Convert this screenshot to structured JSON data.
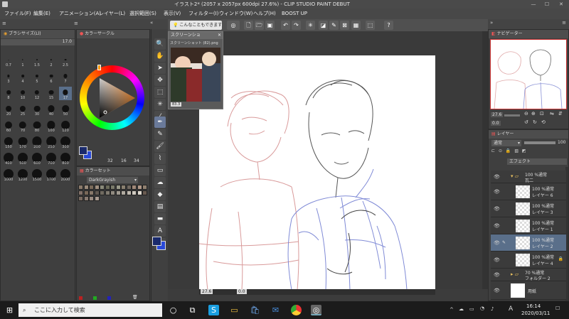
{
  "titlebar": {
    "title": "イラスト2* (2057 x 2057px 600dpi 27.6%) - CLIP STUDIO PAINT DEBUT",
    "minimize": "—",
    "maximize": "☐",
    "close": "✕"
  },
  "menubar": {
    "items": [
      "ファイル(F)",
      "編集(E)",
      "アニメーション(A)",
      "レイヤー(L)",
      "選択範囲(S)",
      "表示(V)",
      "フィルター(I)",
      "ウィンドウ(W)",
      "ヘルプ(H)",
      "BOOST UP"
    ]
  },
  "command_bar": {
    "ask_label": "こんなこともできます"
  },
  "brush_size_panel": {
    "title": "ブラシサイズ(Ll)",
    "value": "17.0",
    "sizes": [
      "0.7",
      "1",
      "1.5",
      "2",
      "2.5",
      "3",
      "4",
      "5",
      "6",
      "7",
      "8",
      "10",
      "12",
      "15",
      "17",
      "20",
      "25",
      "30",
      "40",
      "50",
      "60",
      "70",
      "80",
      "100",
      "120",
      "150",
      "170",
      "200",
      "250",
      "300",
      "400",
      "500",
      "600",
      "700",
      "800",
      "1000",
      "1200",
      "1500",
      "1700",
      "2000"
    ]
  },
  "color_wheel_panel": {
    "title": "カラーサークル",
    "readout": [
      "32",
      "16",
      "34"
    ]
  },
  "color_set_panel": {
    "title": "カラーセット",
    "selected_set": "DarkGrayish"
  },
  "screenshot_window": {
    "title": "スクリーンショ",
    "filename": "スクリーンショット (82).png",
    "zoom": "83.3"
  },
  "navigator": {
    "title": "ナビゲーター",
    "zoom": "27.6",
    "angle": "0.0"
  },
  "layer_panel": {
    "title": "レイヤー",
    "blend_mode": "通常",
    "opacity": "100",
    "layers": [
      {
        "line1": "100 %通常",
        "line2": "瓦二",
        "type": "folder"
      },
      {
        "line1": "100 %通常",
        "line2": "レイヤー 6",
        "type": "raster"
      },
      {
        "line1": "100 %通常",
        "line2": "レイヤー 3",
        "type": "raster"
      },
      {
        "line1": "100 %通常",
        "line2": "レイヤー 1",
        "type": "raster"
      },
      {
        "line1": "100 %通常",
        "line2": "レイヤー 2",
        "type": "raster"
      },
      {
        "line1": "100 %通常",
        "line2": "レイヤー 4",
        "type": "raster"
      },
      {
        "line1": "70 %通常",
        "line2": "フォルダー 2",
        "type": "folder"
      },
      {
        "line1": "",
        "line2": "用紙",
        "type": "paper"
      }
    ],
    "effect_label": "エフェクト"
  },
  "canvas_status": {
    "zoom": "27.6",
    "angle": "0.0"
  },
  "taskbar": {
    "search_placeholder": "ここに入力して検索",
    "time": "16:14",
    "date": "2020/03/11",
    "ime": "A"
  },
  "colors": {
    "main_color": "#1a2a6c",
    "sub_color": "#2a4ad8",
    "accent": "#e67e22"
  }
}
